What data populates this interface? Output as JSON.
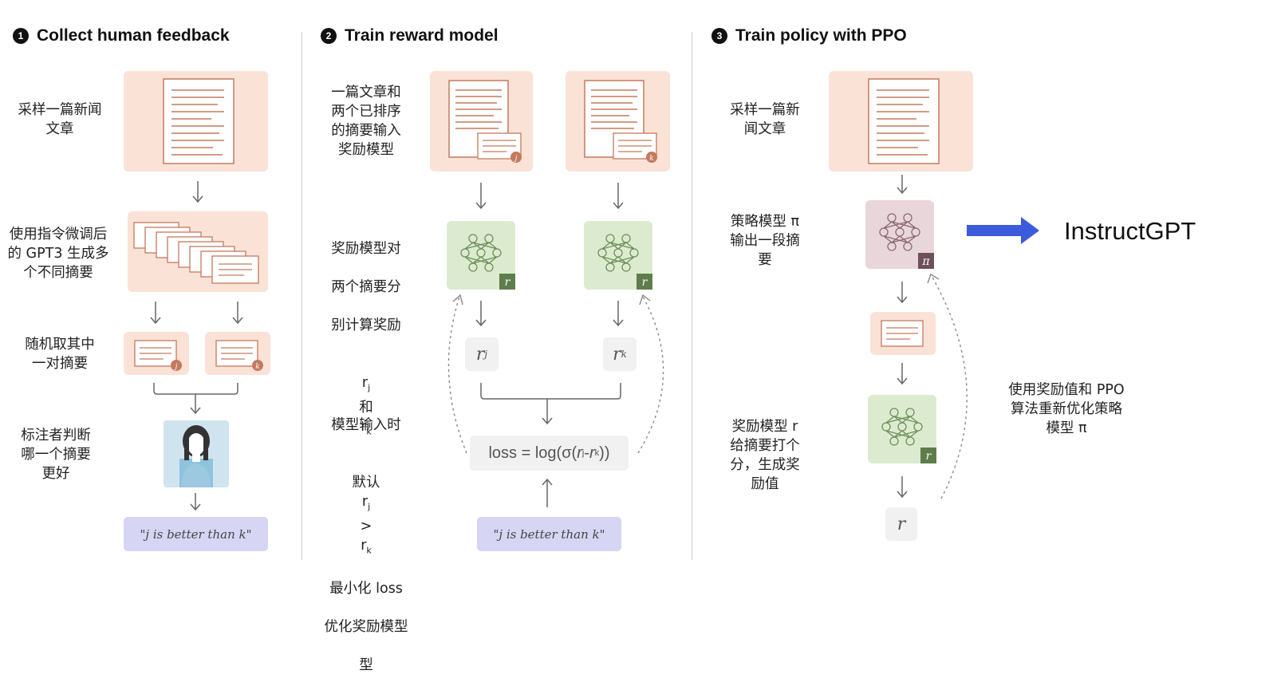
{
  "steps": [
    {
      "number": "1",
      "title": "Collect human feedback"
    },
    {
      "number": "2",
      "title": "Train reward model"
    },
    {
      "number": "3",
      "title": "Train policy with PPO"
    }
  ],
  "col1": {
    "sample_article": "采样一篇新闻\n文章",
    "generate": "使用指令微调后\n的 GPT3 生成多\n个不同摘要",
    "random_pair": "随机取其中\n一对摘要",
    "labeler": "标注者判断\n哪一个摘要\n更好",
    "preference": "\"j is better than k\""
  },
  "col2": {
    "input_desc": "一篇文章和\n两个已排序\n的摘要输入\n奖励模型",
    "reward_calc_lines": [
      "奖励模型对",
      "两个摘要分",
      "别计算奖励"
    ],
    "reward_vars": {
      "r": "r",
      "j": "j",
      "and": "和",
      "k": "k"
    },
    "loss_lines": [
      "模型输入时",
      "最小化 loss",
      "优化奖励模型",
      "型"
    ],
    "loss_default": "默认",
    "gt": ">",
    "loss_formula": {
      "prefix": "loss = log(σ(",
      "minus": " - ",
      "suffix": "))"
    },
    "preference": "\"j is better than k\"",
    "badge": "r",
    "rj_var": "r",
    "rj_sub": "j",
    "rk_sub": "k"
  },
  "col3": {
    "sample_article": "采样一篇新\n闻文章",
    "policy_desc": "策略模型 π\n输出一段摘\n要",
    "reward_desc": "奖励模型 r\n给摘要打个\n分，生成奖\n励值",
    "ppo_desc": "使用奖励值和 PPO\n算法重新优化策略\n模型 π",
    "pi_badge": "π",
    "r_badge": "r",
    "r_output": "r"
  },
  "result": {
    "label": "InstructGPT"
  },
  "colors": {
    "peach": "#fbe2d6",
    "green": "#dcebd0",
    "mauve": "#e9d6da",
    "lavender": "#d6d5f4",
    "arrow_blue": "#3b5bdb",
    "doc_stroke": "#c47a5e"
  }
}
